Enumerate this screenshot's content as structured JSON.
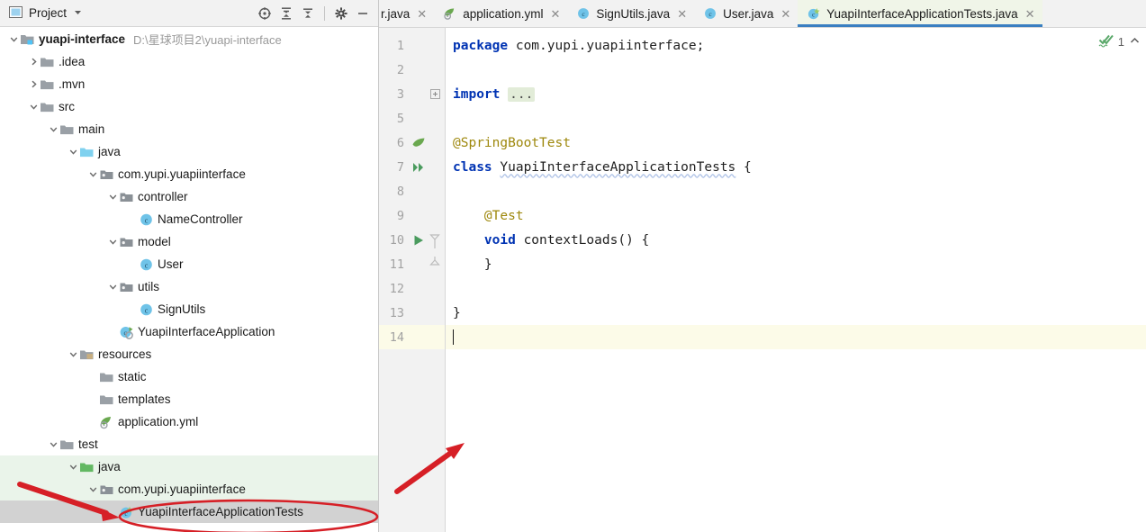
{
  "window": {
    "accent_blue": "#3a7fc1",
    "annotation_red": "#d61f26",
    "test_source_green": "#eaf4ea",
    "selection_gray": "#d2d2d2",
    "current_line_yellow": "#fcfbe8"
  },
  "project_panel": {
    "title": "Project",
    "toolbar": [
      {
        "name": "locate-icon",
        "tooltip": "Select Opened File"
      },
      {
        "name": "expand-all-icon",
        "tooltip": "Expand All"
      },
      {
        "name": "collapse-all-icon",
        "tooltip": "Collapse All"
      },
      {
        "name": "settings-gear-icon",
        "tooltip": "Settings"
      },
      {
        "name": "minimize-icon",
        "tooltip": "Hide"
      }
    ],
    "tree": [
      {
        "label": "yuapi-interface",
        "sublabel": "D:\\星球项目2\\yuapi-interface",
        "indent": 0,
        "arrow": "down",
        "icon": "module-folder-icon",
        "bold": true,
        "state": "normal"
      },
      {
        "label": ".idea",
        "sublabel": "",
        "indent": 1,
        "arrow": "right",
        "icon": "folder-icon",
        "bold": false,
        "state": "normal"
      },
      {
        "label": ".mvn",
        "sublabel": "",
        "indent": 1,
        "arrow": "right",
        "icon": "folder-icon",
        "bold": false,
        "state": "normal"
      },
      {
        "label": "src",
        "sublabel": "",
        "indent": 1,
        "arrow": "down",
        "icon": "folder-icon",
        "bold": false,
        "state": "normal"
      },
      {
        "label": "main",
        "sublabel": "",
        "indent": 2,
        "arrow": "down",
        "icon": "folder-icon",
        "bold": false,
        "state": "normal"
      },
      {
        "label": "java",
        "sublabel": "",
        "indent": 3,
        "arrow": "down",
        "icon": "source-folder-icon",
        "bold": false,
        "state": "normal"
      },
      {
        "label": "com.yupi.yuapiinterface",
        "sublabel": "",
        "indent": 4,
        "arrow": "down",
        "icon": "package-icon",
        "bold": false,
        "state": "normal"
      },
      {
        "label": "controller",
        "sublabel": "",
        "indent": 5,
        "arrow": "down",
        "icon": "package-icon",
        "bold": false,
        "state": "normal"
      },
      {
        "label": "NameController",
        "sublabel": "",
        "indent": 6,
        "arrow": "none",
        "icon": "java-class-icon",
        "bold": false,
        "state": "normal"
      },
      {
        "label": "model",
        "sublabel": "",
        "indent": 5,
        "arrow": "down",
        "icon": "package-icon",
        "bold": false,
        "state": "normal"
      },
      {
        "label": "User",
        "sublabel": "",
        "indent": 6,
        "arrow": "none",
        "icon": "java-class-icon",
        "bold": false,
        "state": "normal"
      },
      {
        "label": "utils",
        "sublabel": "",
        "indent": 5,
        "arrow": "down",
        "icon": "package-icon",
        "bold": false,
        "state": "normal"
      },
      {
        "label": "SignUtils",
        "sublabel": "",
        "indent": 6,
        "arrow": "none",
        "icon": "java-class-icon",
        "bold": false,
        "state": "normal"
      },
      {
        "label": "YuapiInterfaceApplication",
        "sublabel": "",
        "indent": 5,
        "arrow": "none",
        "icon": "spring-class-icon",
        "bold": false,
        "state": "normal"
      },
      {
        "label": "resources",
        "sublabel": "",
        "indent": 3,
        "arrow": "down",
        "icon": "resources-folder-icon",
        "bold": false,
        "state": "normal"
      },
      {
        "label": "static",
        "sublabel": "",
        "indent": 4,
        "arrow": "none",
        "icon": "folder-icon",
        "bold": false,
        "state": "normal"
      },
      {
        "label": "templates",
        "sublabel": "",
        "indent": 4,
        "arrow": "none",
        "icon": "folder-icon",
        "bold": false,
        "state": "normal"
      },
      {
        "label": "application.yml",
        "sublabel": "",
        "indent": 4,
        "arrow": "none",
        "icon": "spring-yaml-icon",
        "bold": false,
        "state": "normal"
      },
      {
        "label": "test",
        "sublabel": "",
        "indent": 2,
        "arrow": "down",
        "icon": "folder-icon",
        "bold": false,
        "state": "normal"
      },
      {
        "label": "java",
        "sublabel": "",
        "indent": 3,
        "arrow": "down",
        "icon": "test-source-folder-icon",
        "bold": false,
        "state": "test-source"
      },
      {
        "label": "com.yupi.yuapiinterface",
        "sublabel": "",
        "indent": 4,
        "arrow": "down",
        "icon": "package-icon",
        "bold": false,
        "state": "test-source"
      },
      {
        "label": "YuapiInterfaceApplicationTests",
        "sublabel": "",
        "indent": 5,
        "arrow": "none",
        "icon": "test-class-icon",
        "bold": false,
        "state": "selected"
      }
    ]
  },
  "editor": {
    "tabs": [
      {
        "label": "r.java",
        "icon": "java-class-icon",
        "active": false,
        "clipped": true
      },
      {
        "label": "application.yml",
        "icon": "spring-yaml-icon",
        "active": false,
        "clipped": false
      },
      {
        "label": "SignUtils.java",
        "icon": "java-class-icon",
        "active": false,
        "clipped": false
      },
      {
        "label": "User.java",
        "icon": "java-class-icon",
        "active": false,
        "clipped": false
      },
      {
        "label": "YuapiInterfaceApplicationTests.java",
        "icon": "test-class-icon",
        "active": true,
        "clipped": false
      }
    ],
    "close_glyph": "✕",
    "inspection": {
      "status_icon": "inspection-ok-icon",
      "count": "1",
      "chevron": "⌃"
    },
    "lines": [
      {
        "num": "1",
        "gutter_icon": "",
        "fold": "",
        "current": false,
        "tokens": [
          {
            "t": "package",
            "c": "kw"
          },
          {
            "t": " com.yupi.yuapiinterface;",
            "c": "plain"
          }
        ]
      },
      {
        "num": "2",
        "gutter_icon": "",
        "fold": "",
        "current": false,
        "tokens": []
      },
      {
        "num": "3",
        "gutter_icon": "",
        "fold": "expand",
        "current": false,
        "tokens": [
          {
            "t": "import",
            "c": "kw"
          },
          {
            "t": " ",
            "c": "plain"
          },
          {
            "t": "...",
            "c": "fold-ph"
          }
        ]
      },
      {
        "num": "5",
        "gutter_icon": "",
        "fold": "",
        "current": false,
        "tokens": []
      },
      {
        "num": "6",
        "gutter_icon": "spring-leaf-icon",
        "fold": "",
        "current": false,
        "tokens": [
          {
            "t": "@SpringBootTest",
            "c": "anno"
          }
        ]
      },
      {
        "num": "7",
        "gutter_icon": "run-all-tests-icon",
        "fold": "",
        "current": false,
        "tokens": [
          {
            "t": "class",
            "c": "kw"
          },
          {
            "t": " ",
            "c": "plain"
          },
          {
            "t": "YuapiInterfaceApplicationTests",
            "c": "squig"
          },
          {
            "t": " {",
            "c": "plain"
          }
        ]
      },
      {
        "num": "8",
        "gutter_icon": "",
        "fold": "",
        "current": false,
        "tokens": []
      },
      {
        "num": "9",
        "gutter_icon": "",
        "fold": "",
        "current": false,
        "tokens": [
          {
            "t": "    @Test",
            "c": "anno"
          }
        ]
      },
      {
        "num": "10",
        "gutter_icon": "run-test-icon",
        "fold": "fold-start",
        "current": false,
        "tokens": [
          {
            "t": "    ",
            "c": "plain"
          },
          {
            "t": "void",
            "c": "kw"
          },
          {
            "t": " ",
            "c": "plain"
          },
          {
            "t": "contextLoads",
            "c": "method"
          },
          {
            "t": "() {",
            "c": "plain"
          }
        ]
      },
      {
        "num": "11",
        "gutter_icon": "",
        "fold": "fold-end",
        "current": false,
        "tokens": [
          {
            "t": "    }",
            "c": "plain"
          }
        ]
      },
      {
        "num": "12",
        "gutter_icon": "",
        "fold": "",
        "current": false,
        "tokens": []
      },
      {
        "num": "13",
        "gutter_icon": "",
        "fold": "",
        "current": false,
        "tokens": [
          {
            "t": "}",
            "c": "plain"
          }
        ]
      },
      {
        "num": "14",
        "gutter_icon": "",
        "fold": "",
        "current": true,
        "tokens": []
      }
    ]
  },
  "annotations": [
    {
      "name": "arrow-to-editor",
      "type": "arrow"
    },
    {
      "name": "arrow-to-test-class",
      "type": "arrow"
    },
    {
      "name": "ellipse-around-test-class",
      "type": "ellipse"
    }
  ]
}
